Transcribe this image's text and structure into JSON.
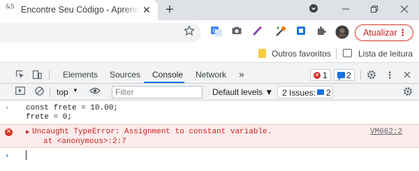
{
  "browser": {
    "tab": {
      "favicon_text": "&S",
      "title": "Encontre Seu Código - Aprenda a",
      "close": "✕"
    },
    "new_tab": "+",
    "window_controls": [
      "minimize",
      "restore",
      "close"
    ],
    "toolbar": {
      "update_label": "Atualizar",
      "update_menu": "⋮"
    },
    "bookmarks": {
      "other_favorites": "Outros favoritos",
      "reading_list": "Lista de leitura"
    }
  },
  "devtools": {
    "tabs": [
      {
        "label": "Elements"
      },
      {
        "label": "Sources"
      },
      {
        "label": "Console"
      },
      {
        "label": "Network"
      },
      {
        "label": "»"
      }
    ],
    "active_tab": "Console",
    "error_count": "1",
    "message_count": "2",
    "console_toolbar": {
      "context": "top",
      "filter_placeholder": "Filter",
      "levels_label": "Default levels ▼",
      "issues_label": "2 Issues:",
      "issues_count": "2"
    },
    "console": {
      "input_line_1": "const frete = 10.00;",
      "input_line_2": "frete = 0;",
      "error_message": "Uncaught TypeError: Assignment to constant variable.",
      "error_stack": "at <anonymous>:2:7",
      "error_source": "VM662:2"
    }
  },
  "colors": {
    "accent": "#1a73e8",
    "error": "#d93025",
    "error_bg": "#fcebeb",
    "tab_strip": "#dee1e6"
  }
}
